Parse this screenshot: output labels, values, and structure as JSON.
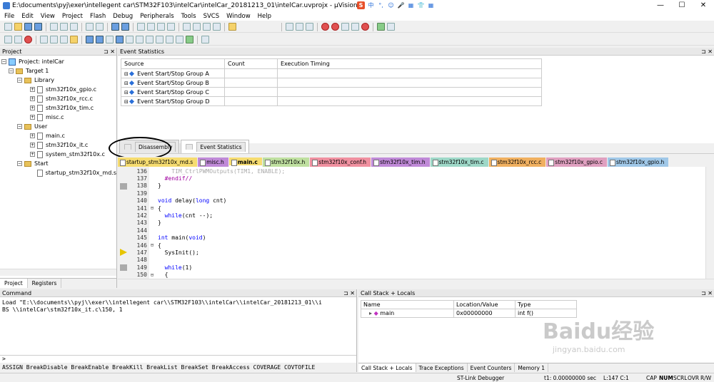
{
  "window": {
    "title": "E:\\documents\\pyj\\exer\\intellegent car\\STM32F103\\intelCar\\intelCar_20181213_01\\intelCar.uvprojx - µVision",
    "controls": [
      "—",
      "☐",
      "✕"
    ]
  },
  "ime": [
    "S",
    "中",
    "°,",
    "☺",
    "🎤",
    "▦",
    "👕",
    "▦"
  ],
  "menu": [
    "File",
    "Edit",
    "View",
    "Project",
    "Flash",
    "Debug",
    "Peripherals",
    "Tools",
    "SVCS",
    "Window",
    "Help"
  ],
  "project": {
    "title": "Project",
    "root": "Project: intelCar",
    "target": "Target 1",
    "groups": [
      {
        "name": "Library",
        "files": [
          "stm32f10x_gpio.c",
          "stm32f10x_rcc.c",
          "stm32f10x_tim.c",
          "misc.c"
        ]
      },
      {
        "name": "User",
        "files": [
          "main.c",
          "stm32f10x_it.c",
          "system_stm32f10x.c"
        ]
      },
      {
        "name": "Start",
        "files": [
          "startup_stm32f10x_md.s"
        ]
      }
    ],
    "tabs": [
      "Project",
      "Registers"
    ]
  },
  "events": {
    "title": "Event Statistics",
    "columns": [
      "Source",
      "Count",
      "Execution Timing"
    ],
    "rows": [
      "Event Start/Stop Group A",
      "Event Start/Stop Group B",
      "Event Start/Stop Group C",
      "Event Start/Stop Group D"
    ]
  },
  "midtabs": [
    "Disassembly",
    "Event Statistics"
  ],
  "filetabs": [
    {
      "label": "startup_stm32f10x_md.s",
      "color": "#f6dc70"
    },
    {
      "label": "misc.h",
      "color": "#c08ad8"
    },
    {
      "label": "main.c",
      "color": "#f6dc70"
    },
    {
      "label": "stm32f10x.h",
      "color": "#bfe0a0"
    },
    {
      "label": "stm32f10x_conf.h",
      "color": "#f090a0"
    },
    {
      "label": "stm32f10x_tim.h",
      "color": "#c08ad8"
    },
    {
      "label": "stm32f10x_tim.c",
      "color": "#9ed8c8"
    },
    {
      "label": "stm32f10x_rcc.c",
      "color": "#f0b060"
    },
    {
      "label": "stm32f10x_gpio.c",
      "color": "#e0a0c0"
    },
    {
      "label": "stm32f10x_gpio.h",
      "color": "#a0c8e8"
    }
  ],
  "code": [
    {
      "ln": "136",
      "fold": "",
      "text": "    TIM_CtrlPWMOutputs(TIM1, ENABLE);",
      "dim": true
    },
    {
      "ln": "137",
      "fold": "",
      "text": "  #endif//",
      "dim": false
    },
    {
      "ln": "138",
      "fold": "",
      "text": "}",
      "dim": false
    },
    {
      "ln": "139",
      "fold": "",
      "text": "",
      "dim": false
    },
    {
      "ln": "140",
      "fold": "",
      "text": "void delay(long cnt)",
      "dim": false
    },
    {
      "ln": "141",
      "fold": "⊟",
      "text": "{",
      "dim": false
    },
    {
      "ln": "142",
      "fold": "",
      "text": "  while(cnt --);",
      "dim": false
    },
    {
      "ln": "143",
      "fold": "",
      "text": "}",
      "dim": false
    },
    {
      "ln": "144",
      "fold": "",
      "text": "",
      "dim": false
    },
    {
      "ln": "145",
      "fold": "",
      "text": "int main(void)",
      "dim": false
    },
    {
      "ln": "146",
      "fold": "⊟",
      "text": "{",
      "dim": false
    },
    {
      "ln": "147",
      "fold": "",
      "text": "  SysInit();",
      "dim": false
    },
    {
      "ln": "148",
      "fold": "",
      "text": "",
      "dim": false
    },
    {
      "ln": "149",
      "fold": "",
      "text": "  while(1)",
      "dim": false
    },
    {
      "ln": "150",
      "fold": "⊟",
      "text": "  {",
      "dim": false
    }
  ],
  "command": {
    "title": "Command",
    "output": "Load \"E:\\\\documents\\\\pyj\\\\exer\\\\intellegent car\\\\STM32F103\\\\intelCar\\\\intelCar_20181213_01\\\\i\nBS \\\\intelCar\\stm32f10x_it.c\\150, 1",
    "prompt": ">",
    "help": "ASSIGN BreakDisable BreakEnable BreakKill BreakList BreakSet BreakAccess COVERAGE COVTOFILE"
  },
  "callstack": {
    "title": "Call Stack + Locals",
    "columns": [
      "Name",
      "Location/Value",
      "Type"
    ],
    "rows": [
      {
        "name": "main",
        "value": "0x00000000",
        "type": "int f()"
      }
    ],
    "tabs": [
      "Call Stack + Locals",
      "Trace Exceptions",
      "Event Counters",
      "Memory 1"
    ]
  },
  "status": {
    "debugger": "ST-Link Debugger",
    "time": "t1: 0.00000000 sec",
    "pos": "L:147 C:1",
    "flags": [
      "CAP",
      "NUM",
      "SCRL",
      "OVR",
      "R/W"
    ]
  },
  "watermark": {
    "text": "Baidu经验",
    "sub": "jingyan.baidu.com"
  }
}
